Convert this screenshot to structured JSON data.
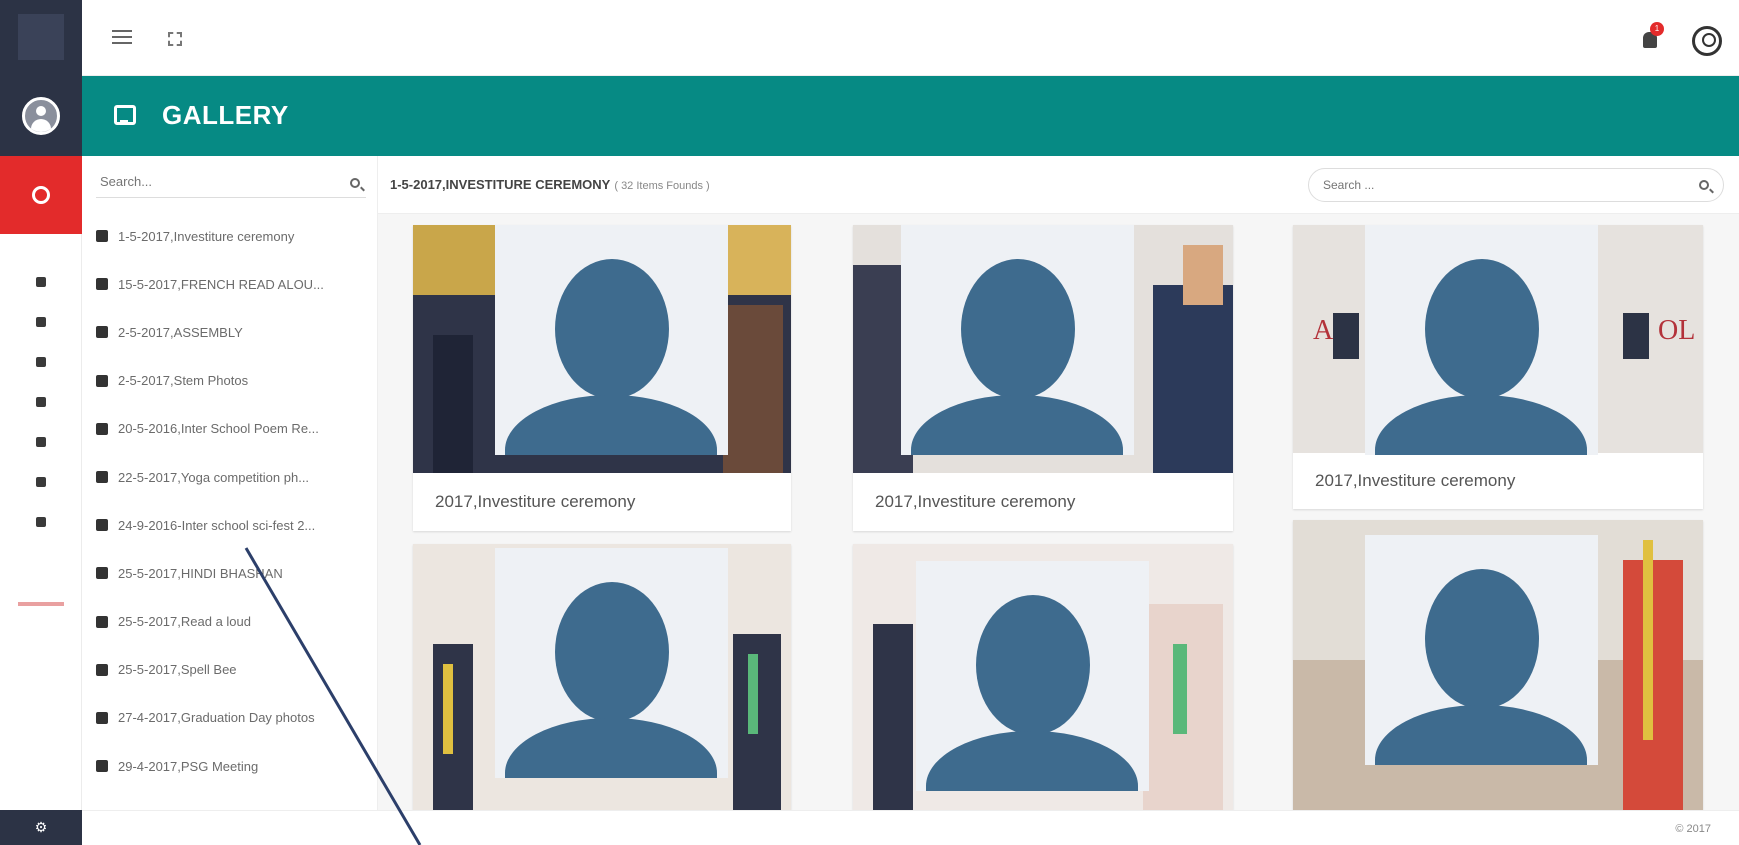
{
  "header": {
    "title": "GALLERY"
  },
  "topbar": {
    "notification_count": "1"
  },
  "album_panel": {
    "search_placeholder": "Search...",
    "albums": [
      "1-5-2017,Investiture ceremony",
      "15-5-2017,FRENCH READ ALOU...",
      "2-5-2017,ASSEMBLY",
      "2-5-2017,Stem Photos",
      "20-5-2016,Inter School Poem Re...",
      "22-5-2017,Yoga competition ph...",
      "24-9-2016-Inter school sci-fest 2...",
      "25-5-2017,HINDI BHASHAN",
      "25-5-2017,Read a loud",
      "25-5-2017,Spell Bee",
      "27-4-2017,Graduation Day photos",
      "29-4-2017,PSG Meeting"
    ]
  },
  "content": {
    "title": "1-5-2017,INVESTITURE CEREMONY",
    "count": "( 32 Items Founds )",
    "search_placeholder": "Search ..."
  },
  "cards": [
    {
      "caption": "2017,Investiture ceremony"
    },
    {
      "caption": "2017,Investiture ceremony"
    },
    {
      "caption": "2017,Investiture ceremony"
    },
    {
      "caption": ""
    },
    {
      "caption": ""
    },
    {
      "caption": ""
    }
  ],
  "footer": {
    "text": "© 2017"
  },
  "colors": {
    "header": "#068a84",
    "rail_dark": "#2c3345",
    "rail_active": "#e32b2b",
    "placeholder_figure": "#3e6b8e"
  },
  "icons": [
    "hamburger-icon",
    "expand-icon",
    "bell-icon",
    "user-icon",
    "gallery-icon",
    "search-icon",
    "album-icon",
    "settings-icon"
  ]
}
